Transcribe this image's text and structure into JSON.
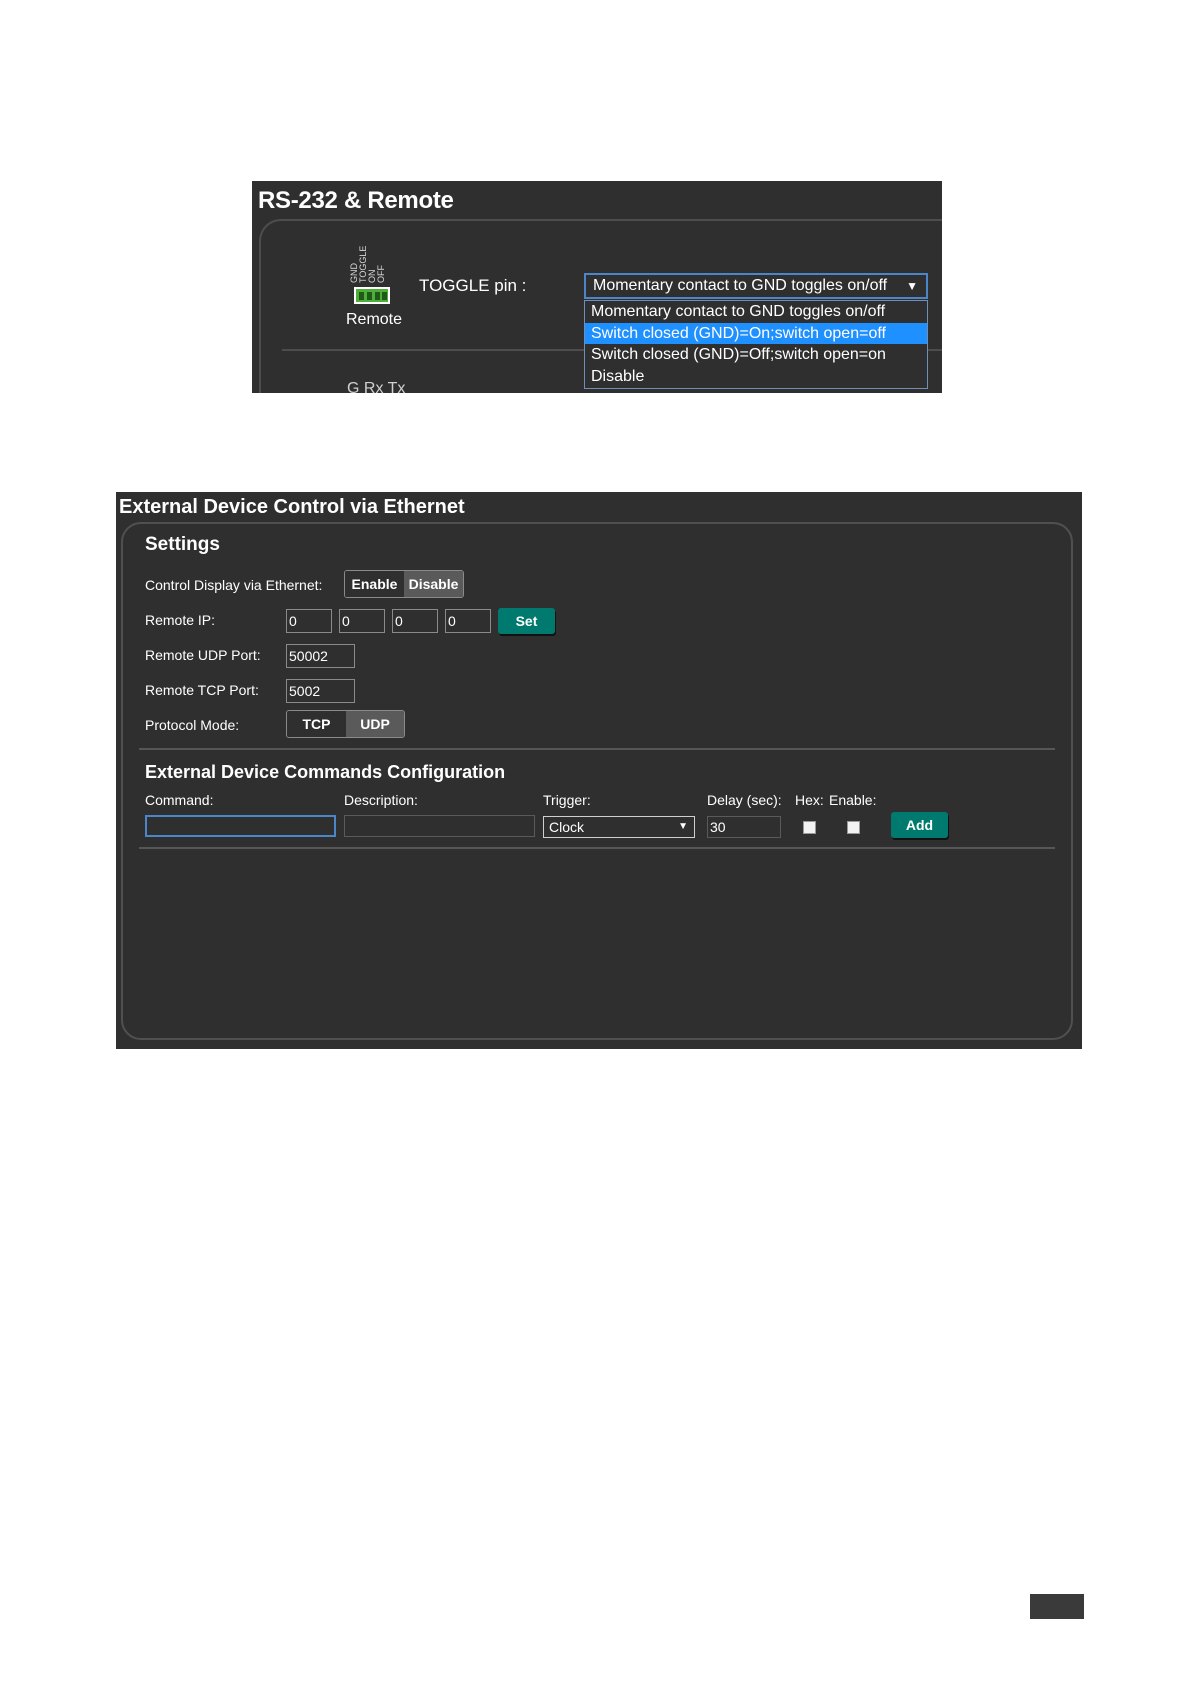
{
  "rs232": {
    "title": "RS-232 & Remote",
    "connector_labels": [
      "TOGGLE",
      "ON",
      "OFF",
      "GND"
    ],
    "remote_label": "Remote",
    "toggle_label": "TOGGLE pin :",
    "toggle_select": {
      "value": "Momentary contact to GND toggles on/off",
      "arrow": "▼"
    },
    "options": [
      {
        "label": "Momentary contact to GND toggles on/off",
        "selected": false
      },
      {
        "label": "Switch closed (GND)=On;switch open=off",
        "selected": true
      },
      {
        "label": "Switch closed (GND)=Off;switch open=on",
        "selected": false
      },
      {
        "label": "Disable",
        "selected": false
      }
    ],
    "cut_label": "G Rx Tx",
    "highlight_color": "#1e90ff"
  },
  "external": {
    "title": "External Device Control via Ethernet",
    "settings": {
      "heading": "Settings",
      "control_label": "Control Display via Ethernet:",
      "enable_label": "Enable",
      "disable_label": "Disable",
      "remote_ip_label": "Remote IP:",
      "ip": [
        "0",
        "0",
        "0",
        "0"
      ],
      "set_label": "Set",
      "udp_port_label": "Remote UDP Port:",
      "udp_port": "50002",
      "tcp_port_label": "Remote TCP Port:",
      "tcp_port": "5002",
      "protocol_label": "Protocol Mode:",
      "tcp_label": "TCP",
      "udp_label": "UDP"
    },
    "commands": {
      "heading": "External Device Commands Configuration",
      "command_label": "Command:",
      "description_label": "Description:",
      "trigger_label": "Trigger:",
      "delay_label": "Delay (sec):",
      "hex_label": "Hex:",
      "enable_label": "Enable:",
      "command_value": "",
      "description_value": "",
      "trigger_value": "Clock",
      "trigger_arrow": "▼",
      "delay_value": "30",
      "add_label": "Add"
    },
    "accent_color": "#007a6e"
  }
}
